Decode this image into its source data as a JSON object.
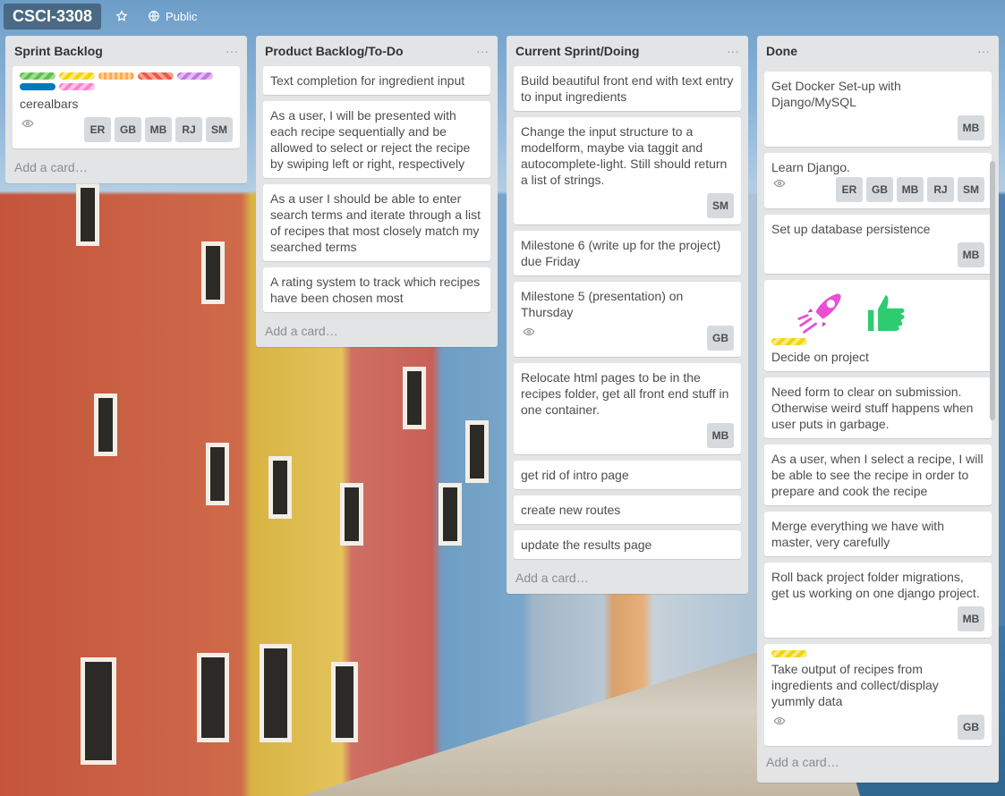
{
  "board": {
    "title": "CSCI-3308",
    "visibility": "Public"
  },
  "colors": {
    "list_bg": "#e2e4e6",
    "label_colors": [
      "#61bd4f",
      "#f2d600",
      "#ffab4a",
      "#eb5a46",
      "#c377e0",
      "#0079bf",
      "#ff80ce"
    ]
  },
  "lists": [
    {
      "title": "Sprint Backlog",
      "add_card": "Add a card…",
      "cards": [
        {
          "title": "cerealbars",
          "labels": 7,
          "watch": true,
          "members": [
            "ER",
            "GB",
            "MB",
            "RJ",
            "SM"
          ]
        }
      ]
    },
    {
      "title": "Product Backlog/To-Do",
      "add_card": "Add a card…",
      "cards": [
        {
          "title": "Text completion for ingredient input"
        },
        {
          "title": "As a user, I will be presented with each recipe sequentially and be allowed to select or reject the recipe by swiping left or right, respectively"
        },
        {
          "title": "As a user I should be able to enter search terms and iterate through a list of recipes that most closely match my searched terms"
        },
        {
          "title": "A rating system to track which recipes have been chosen most"
        }
      ]
    },
    {
      "title": "Current Sprint/Doing",
      "add_card": "Add a card…",
      "cards": [
        {
          "title": "Build beautiful front end with text entry to input ingredients"
        },
        {
          "title": "Change the input structure to a modelform, maybe via taggit and autocomplete-light. Still should return a list of strings.",
          "members": [
            "SM"
          ]
        },
        {
          "title": "Milestone 6 (write up for the project) due Friday"
        },
        {
          "title": "Milestone 5 (presentation) on Thursday",
          "watch": true,
          "members": [
            "GB"
          ]
        },
        {
          "title": "Relocate html pages to be in the recipes folder, get all front end stuff in one container.",
          "members": [
            "MB"
          ]
        },
        {
          "title": "get rid of intro page"
        },
        {
          "title": "create new routes"
        },
        {
          "title": "update the results page"
        }
      ]
    },
    {
      "title": "Done",
      "add_card": "Add a card…",
      "cards": [
        {
          "title": "Get Docker Set-up with Django/MySQL",
          "members": [
            "MB"
          ]
        },
        {
          "title": "Learn Django.",
          "watch": true,
          "members": [
            "ER",
            "GB",
            "MB",
            "RJ",
            "SM"
          ]
        },
        {
          "title": "Set up database persistence",
          "members": [
            "MB"
          ]
        },
        {
          "title": "Decide on project",
          "stickers": [
            "rocket-sticker",
            "thumbs-up-sticker"
          ],
          "labels": 1
        },
        {
          "title": "Need form to clear on submission. Otherwise weird stuff happens when user puts in garbage."
        },
        {
          "title": "As a user, when I select a recipe, I will be able to see the recipe in order to prepare and cook the recipe"
        },
        {
          "title": "Merge everything we have with master, very carefully"
        },
        {
          "title": "Roll back project folder migrations, get us working on one django project.",
          "members": [
            "MB"
          ]
        },
        {
          "title": "Take output of recipes from ingredients and collect/display yummly data",
          "labels": 1,
          "watch": true,
          "members": [
            "GB"
          ]
        }
      ]
    }
  ]
}
